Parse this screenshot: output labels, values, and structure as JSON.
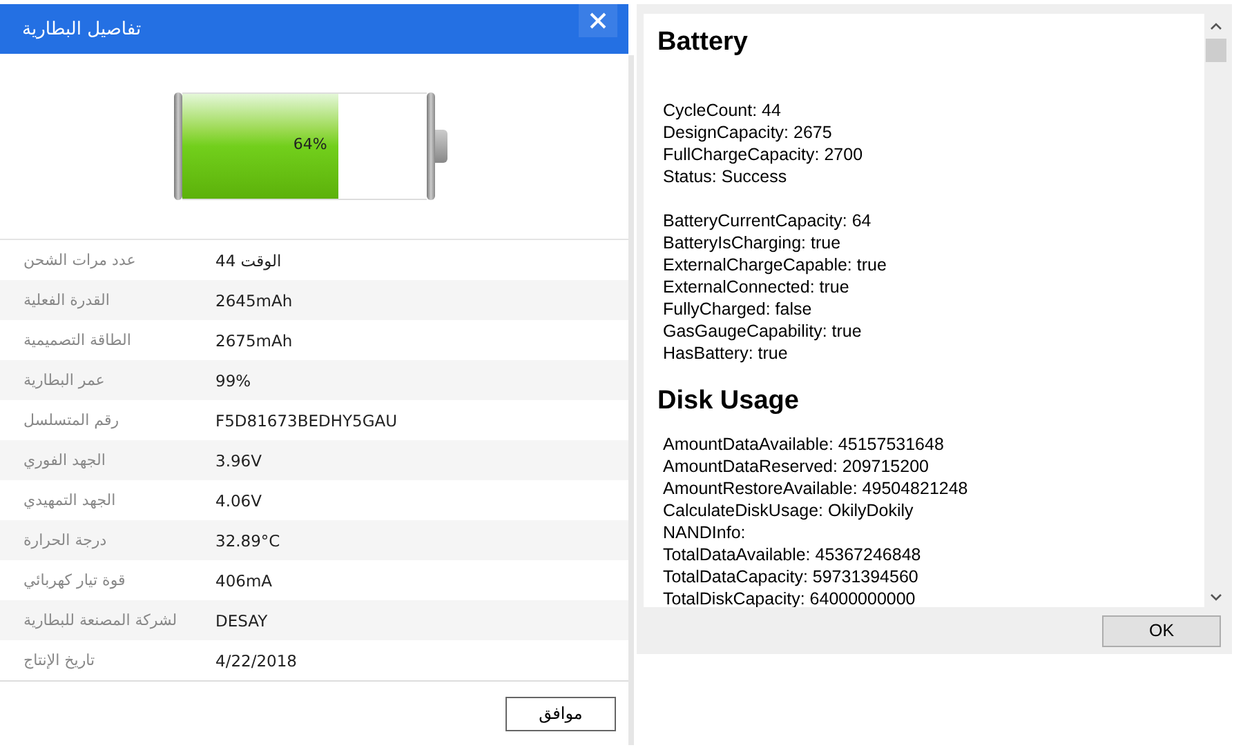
{
  "battery_dialog": {
    "title": "تفاصيل البطارية",
    "battery": {
      "level": 0.64,
      "reading": "64%"
    },
    "details": [
      {
        "label": "عدد مرات الشحن",
        "value": "الوقت 44"
      },
      {
        "label": "القدرة الفعلية",
        "value": "2645mAh"
      },
      {
        "label": "الطاقة التصميمية",
        "value": "2675mAh"
      },
      {
        "label": "عمر البطارية",
        "value": "99%"
      },
      {
        "label": "رقم المتسلسل",
        "value": "F5D81673BEDHY5GAU"
      },
      {
        "label": "الجهد الفوري",
        "value": "3.96V"
      },
      {
        "label": "الجهد التمهيدي",
        "value": "4.06V"
      },
      {
        "label": "درجة الحرارة",
        "value": "32.89°C"
      },
      {
        "label": "قوة تيار كهربائي",
        "value": "406mA"
      },
      {
        "label": "لشركة المصنعة للبطارية",
        "value": "DESAY"
      },
      {
        "label": "تاريخ الإنتاج",
        "value": "4/22/2018"
      }
    ],
    "buttons": [
      "موافق"
    ]
  },
  "report_window": {
    "sections": [
      {
        "heading": "Battery",
        "groups": [
          [
            "CycleCount: 44",
            "DesignCapacity: 2675",
            "FullChargeCapacity: 2700",
            "Status: Success"
          ],
          [
            "BatteryCurrentCapacity: 64",
            "BatteryIsCharging: true",
            "ExternalChargeCapable: true",
            "ExternalConnected: true",
            "FullyCharged: false",
            "GasGaugeCapability: true",
            "HasBattery: true"
          ]
        ]
      },
      {
        "heading": "Disk Usage",
        "groups": [
          [
            "AmountDataAvailable: 45157531648",
            "AmountDataReserved: 209715200",
            "AmountRestoreAvailable: 49504821248",
            "CalculateDiskUsage: OkilyDokily",
            "NANDInfo:",
            "TotalDataAvailable: 45367246848",
            "TotalDataCapacity: 59731394560",
            "TotalDiskCapacity: 64000000000"
          ]
        ]
      }
    ],
    "buttons": [
      "OK"
    ]
  }
}
